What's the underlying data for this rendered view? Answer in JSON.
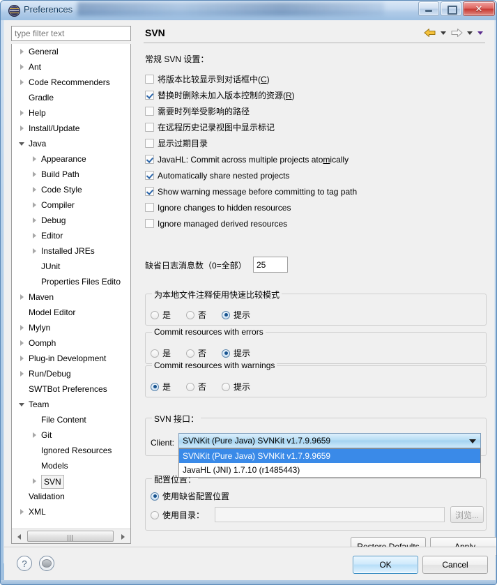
{
  "window": {
    "title": "Preferences",
    "app_icon": "eclipse-icon",
    "controls": {
      "minimize": "minimize-icon",
      "maximize": "maximize-icon",
      "close": "✕"
    }
  },
  "sidebar": {
    "filter_placeholder": "type filter text",
    "filter_value": "",
    "items": [
      {
        "label": "General",
        "indent": 0,
        "arrow": "collapsed"
      },
      {
        "label": "Ant",
        "indent": 0,
        "arrow": "collapsed"
      },
      {
        "label": "Code Recommenders",
        "indent": 0,
        "arrow": "collapsed"
      },
      {
        "label": "Gradle",
        "indent": 0,
        "arrow": "none"
      },
      {
        "label": "Help",
        "indent": 0,
        "arrow": "collapsed"
      },
      {
        "label": "Install/Update",
        "indent": 0,
        "arrow": "collapsed"
      },
      {
        "label": "Java",
        "indent": 0,
        "arrow": "expanded"
      },
      {
        "label": "Appearance",
        "indent": 1,
        "arrow": "collapsed"
      },
      {
        "label": "Build Path",
        "indent": 1,
        "arrow": "collapsed"
      },
      {
        "label": "Code Style",
        "indent": 1,
        "arrow": "collapsed"
      },
      {
        "label": "Compiler",
        "indent": 1,
        "arrow": "collapsed"
      },
      {
        "label": "Debug",
        "indent": 1,
        "arrow": "collapsed"
      },
      {
        "label": "Editor",
        "indent": 1,
        "arrow": "collapsed"
      },
      {
        "label": "Installed JREs",
        "indent": 1,
        "arrow": "collapsed"
      },
      {
        "label": "JUnit",
        "indent": 1,
        "arrow": "none"
      },
      {
        "label": "Properties Files Edito",
        "indent": 1,
        "arrow": "none"
      },
      {
        "label": "Maven",
        "indent": 0,
        "arrow": "collapsed"
      },
      {
        "label": "Model Editor",
        "indent": 0,
        "arrow": "none"
      },
      {
        "label": "Mylyn",
        "indent": 0,
        "arrow": "collapsed"
      },
      {
        "label": "Oomph",
        "indent": 0,
        "arrow": "collapsed"
      },
      {
        "label": "Plug-in Development",
        "indent": 0,
        "arrow": "collapsed"
      },
      {
        "label": "Run/Debug",
        "indent": 0,
        "arrow": "collapsed"
      },
      {
        "label": "SWTBot Preferences",
        "indent": 0,
        "arrow": "none"
      },
      {
        "label": "Team",
        "indent": 0,
        "arrow": "expanded"
      },
      {
        "label": "File Content",
        "indent": 1,
        "arrow": "none"
      },
      {
        "label": "Git",
        "indent": 1,
        "arrow": "collapsed"
      },
      {
        "label": "Ignored Resources",
        "indent": 1,
        "arrow": "none"
      },
      {
        "label": "Models",
        "indent": 1,
        "arrow": "none"
      },
      {
        "label": "SVN",
        "indent": 1,
        "arrow": "collapsed",
        "selected": true
      },
      {
        "label": "Validation",
        "indent": 0,
        "arrow": "none"
      },
      {
        "label": "XML",
        "indent": 0,
        "arrow": "collapsed"
      }
    ]
  },
  "page": {
    "title": "SVN",
    "nav": {
      "back": "back-arrow-icon",
      "forward": "forward-arrow-icon",
      "menu": "dropdown-menu-icon"
    },
    "general_label": "常规 SVN 设置：",
    "checkboxes": [
      {
        "label": "将版本比较显示到对话框中(C)",
        "mnemonic": "C",
        "checked": false
      },
      {
        "label": "替换时删除未加入版本控制的资源(R)",
        "mnemonic": "R",
        "checked": true
      },
      {
        "label": "需要时列举受影响的路径",
        "checked": false
      },
      {
        "label": "在远程历史记录视图中显示标记",
        "checked": false
      },
      {
        "label": "显示过期目录",
        "checked": false
      },
      {
        "label": "JavaHL: Commit across multiple projects atomically",
        "mnemonic": "m",
        "checked": true
      },
      {
        "label": "Automatically share nested projects",
        "checked": true
      },
      {
        "label": "Show warning message before committing to tag path",
        "checked": true
      },
      {
        "label": "Ignore changes to hidden resources",
        "checked": false
      },
      {
        "label": "Ignore managed derived resources",
        "checked": false
      }
    ],
    "log_messages": {
      "label": "缺省日志消息数（0=全部）",
      "value": "25"
    },
    "radio_groups": [
      {
        "title": "为本地文件注释使用快速比较模式",
        "options": [
          {
            "label": "是",
            "selected": false
          },
          {
            "label": "否",
            "selected": false
          },
          {
            "label": "提示",
            "selected": true
          }
        ]
      },
      {
        "title": "Commit resources with errors",
        "options": [
          {
            "label": "是",
            "selected": false
          },
          {
            "label": "否",
            "selected": false
          },
          {
            "label": "提示",
            "selected": true
          }
        ]
      },
      {
        "title": "Commit resources with warnings",
        "options": [
          {
            "label": "是",
            "selected": true
          },
          {
            "label": "否",
            "selected": false
          },
          {
            "label": "提示",
            "selected": false
          }
        ]
      }
    ],
    "svn_interface": {
      "title": "SVN 接口：",
      "client_label": "Client:",
      "selected": "SVNKit (Pure Java) SVNKit v1.7.9.9659",
      "options": [
        {
          "label": "SVNKit (Pure Java) SVNKit v1.7.9.9659",
          "selected": true
        },
        {
          "label": "JavaHL (JNI) 1.7.10 (r1485443)",
          "selected": false
        }
      ]
    },
    "config_location": {
      "title": "配置位置：",
      "use_default": {
        "label": "使用缺省配置位置",
        "selected": true
      },
      "use_directory": {
        "label": "使用目录：",
        "selected": false,
        "value": ""
      },
      "browse_label": "浏览..."
    },
    "page_buttons": {
      "restore": "Restore Defaults",
      "restore_mnemonic": "D",
      "apply": "Apply",
      "apply_mnemonic": "A"
    }
  },
  "footer": {
    "help_icon": "?",
    "disk_icon": "disk-icon",
    "ok": "OK",
    "cancel": "Cancel"
  },
  "colors": {
    "accent": "#3a8ae8",
    "title_text": "#123a5e",
    "close_button": "#c83c35",
    "back_arrow": "#e8a317",
    "menu_arrow": "#5b2d8e"
  }
}
